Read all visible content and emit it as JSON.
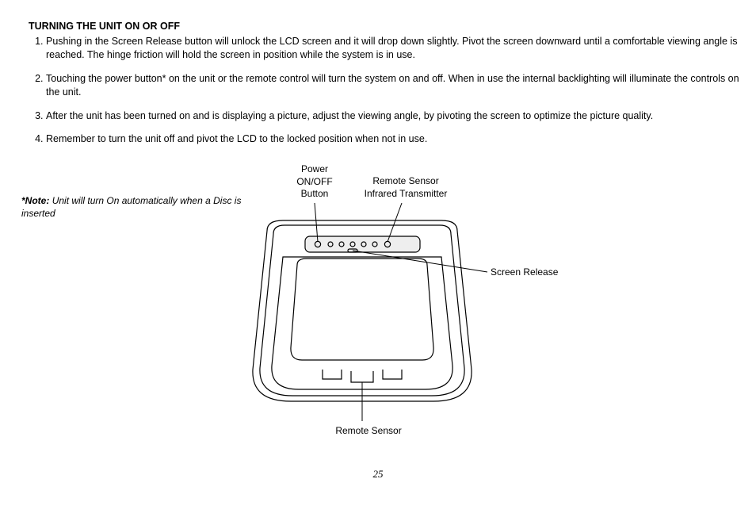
{
  "heading": "TURNING THE UNIT ON OR OFF",
  "list": {
    "i1": "Pushing in the Screen Release button will unlock the LCD screen and it will drop down slightly. Pivot the screen downward until a comfortable viewing angle is reached. The hinge friction will hold the screen in position while the system is in use.",
    "i2": "Touching the power button* on the unit or the remote control will turn the system on and off. When in use the internal backlighting will illuminate the controls on the unit.",
    "i3": "After the unit has been turned on and is displaying a picture, adjust the viewing angle, by pivoting the screen to optimize the picture quality.",
    "i4": "Remember to turn the unit off and pivot the LCD to the locked position when not in use."
  },
  "note": {
    "label": "*Note:",
    "text": "Unit will turn On automatically when a Disc is inserted"
  },
  "labels": {
    "power_l1": "Power",
    "power_l2": "ON/OFF",
    "power_l3": "Button",
    "sensor_l1": "Remote Sensor",
    "sensor_l2": "Infrared Transmitter",
    "screen_release": "Screen Release",
    "remote_sensor_bottom": "Remote Sensor"
  },
  "page_number": "25"
}
